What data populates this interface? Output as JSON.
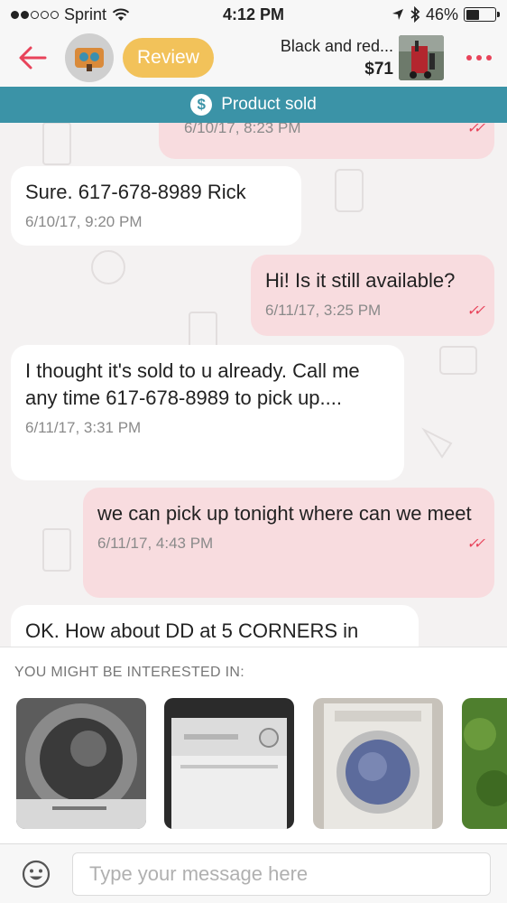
{
  "status_bar": {
    "carrier": "Sprint",
    "time": "4:12 PM",
    "battery": "46%",
    "battery_level": 0.46,
    "signal_bars_filled": 2,
    "signal_bars_total": 5
  },
  "header": {
    "review_label": "Review",
    "product_title": "Black and red...",
    "product_price": "$71"
  },
  "banner": {
    "icon": "$",
    "text": "Product sold"
  },
  "messages": [
    {
      "direction": "out",
      "text": "",
      "time": "6/10/17, 8:23 PM",
      "read": true
    },
    {
      "direction": "in",
      "text": "Sure. 617-678-8989 Rick",
      "time": "6/10/17, 9:20 PM"
    },
    {
      "direction": "out",
      "text": "Hi! Is it still available?",
      "time": "6/11/17, 3:25 PM",
      "read": true
    },
    {
      "direction": "in",
      "text": "I thought it's sold to u already. Call me any time 617-678-8989 to pick up....",
      "time": "6/11/17, 3:31 PM"
    },
    {
      "direction": "out",
      "text": "we can pick up tonight where can we meet",
      "time": "6/11/17, 4:43 PM",
      "read": true
    },
    {
      "direction": "in",
      "text": "OK. How about DD at 5 CORNERS in",
      "time": ""
    }
  ],
  "suggestions": {
    "title": "YOU MIGHT BE INTERESTED IN:",
    "items": [
      {
        "icon": "dryer-drum-photo"
      },
      {
        "icon": "washer-top-photo"
      },
      {
        "icon": "front-load-washer-photo"
      },
      {
        "icon": "grass-photo"
      }
    ]
  },
  "input": {
    "placeholder": "Type your message here",
    "value": ""
  },
  "colors": {
    "accent": "#e8435a",
    "review": "#f2c25a",
    "banner": "#3b93a7",
    "outgoing_bubble": "#f8dcdf",
    "incoming_bubble": "#ffffff"
  }
}
